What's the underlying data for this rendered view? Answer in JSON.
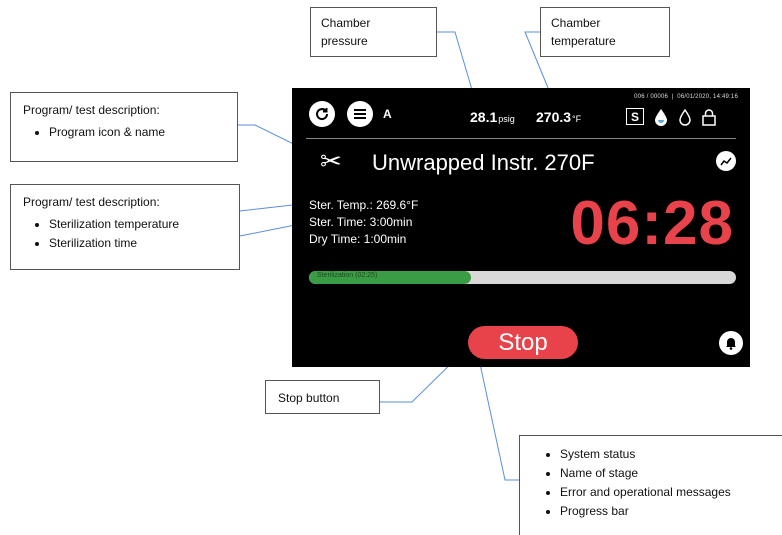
{
  "callouts": {
    "pressure": {
      "line1": "Chamber",
      "line2": "pressure"
    },
    "temperature": {
      "line1": "Chamber",
      "line2": "temperature"
    },
    "program_icon": {
      "title": "Program/ test description:",
      "items": [
        "Program icon & name"
      ]
    },
    "program_params": {
      "title": "Program/ test description:",
      "items": [
        "Sterilization temperature",
        "Sterilization time"
      ]
    },
    "stop": {
      "label": "Stop button"
    },
    "status": {
      "items": [
        "System status",
        "Name of stage",
        "Error and operational messages",
        "Progress bar"
      ]
    }
  },
  "screen": {
    "mode_label": "A",
    "pressure_value": "28.1",
    "pressure_unit": "psig",
    "temperature_value": "270.3",
    "temperature_unit": "°F",
    "cycle_number": "006 / 00006",
    "datetime": "06/01/2020, 14:49:16",
    "s_label": "S",
    "program_name": "Unwrapped Instr. 270F",
    "ster_temp": "Ster. Temp.: 269.6°F",
    "ster_time": "Ster. Time: 3:00min",
    "dry_time": "Dry Time: 1:00min",
    "timer": "06:28",
    "progress_label": "Sterilization (02:25)",
    "progress_fraction": 0.38,
    "stop_label": "Stop",
    "colors": {
      "accent_red": "#e8424a",
      "progress_green": "#3a9d45"
    },
    "icons": [
      "refresh-icon",
      "menu-icon",
      "water-drop-filled-icon",
      "water-drop-outline-icon",
      "lock-icon",
      "scissors-icon",
      "chart-icon",
      "bell-icon"
    ]
  }
}
